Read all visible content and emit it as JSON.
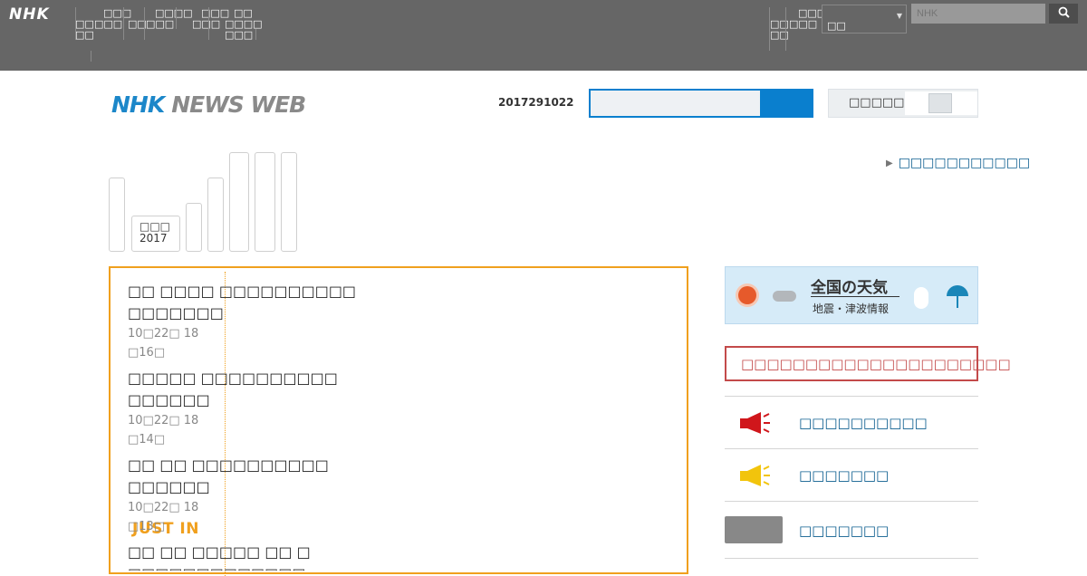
{
  "global_nav": {
    "logo": "NHK",
    "items": [
      [
        "□□",
        "□□"
      ],
      [
        "□□□",
        "□□□"
      ],
      [
        "□□"
      ],
      [
        "□□□□",
        "□□□"
      ],
      [
        "□□□",
        "□□□"
      ],
      [
        "□□",
        "□□□□",
        "□□□"
      ]
    ],
    "right_items": [
      [
        "□□",
        "□□"
      ],
      [
        "□□□",
        "□□□"
      ]
    ],
    "region_value": "□□",
    "search_placeholder": "NHK",
    "search_icon": "search-icon"
  },
  "header": {
    "brand_nhk": "NHK",
    "brand_newsweb": "NEWS WEB",
    "date_code": "2017291022",
    "search_value": "",
    "toggle_label": "□□□□□"
  },
  "tabs": {
    "active_label_line1": "□□□",
    "active_label_line2": "2017",
    "right_link": "□□□□□□□□□□□"
  },
  "justin": {
    "tag": "JUST IN",
    "items": [
      {
        "title_line1": "□□ □□□□ □□□□□□□□□□",
        "title_line2": "□□□□□□□",
        "time": "10□22□ 18",
        "ago": "□16□"
      },
      {
        "title_line1": "□□□□□ □□□□□□□□□□",
        "title_line2": "□□□□□□",
        "time": "10□22□ 18",
        "ago": "□14□"
      },
      {
        "title_line1": "□□ □□ □□□□□□□□□□",
        "title_line2": "□□□□□□",
        "time": "10□22□ 18",
        "ago": "□13□"
      },
      {
        "title_line1": "□□ □□ □□□□□ □□ □",
        "title_line2": "□□□□□□□□□□□□□",
        "time": "",
        "ago": ""
      }
    ]
  },
  "sidebar": {
    "weather_title": "全国の天気",
    "weather_sub": "地震・津波情報",
    "alert_text": "□□□□□□□□□□□□□□□□□□□□□",
    "rows": [
      {
        "label": "□□□□□□□□□□",
        "icon": "megaphone-icon",
        "icon_color": "#d0161b"
      },
      {
        "label": "□□□□□□□",
        "icon": "megaphone-icon",
        "icon_color": "#f2c40c"
      },
      {
        "label": "□□□□□□□",
        "icon": "thumbnail-image",
        "icon_color": "#888888"
      }
    ]
  },
  "colors": {
    "topbar": "#666666",
    "brand_blue": "#1c87c9",
    "accent_orange": "#f0a01e",
    "link_blue": "#0b5d8f",
    "alert_red": "#c34a4a"
  }
}
